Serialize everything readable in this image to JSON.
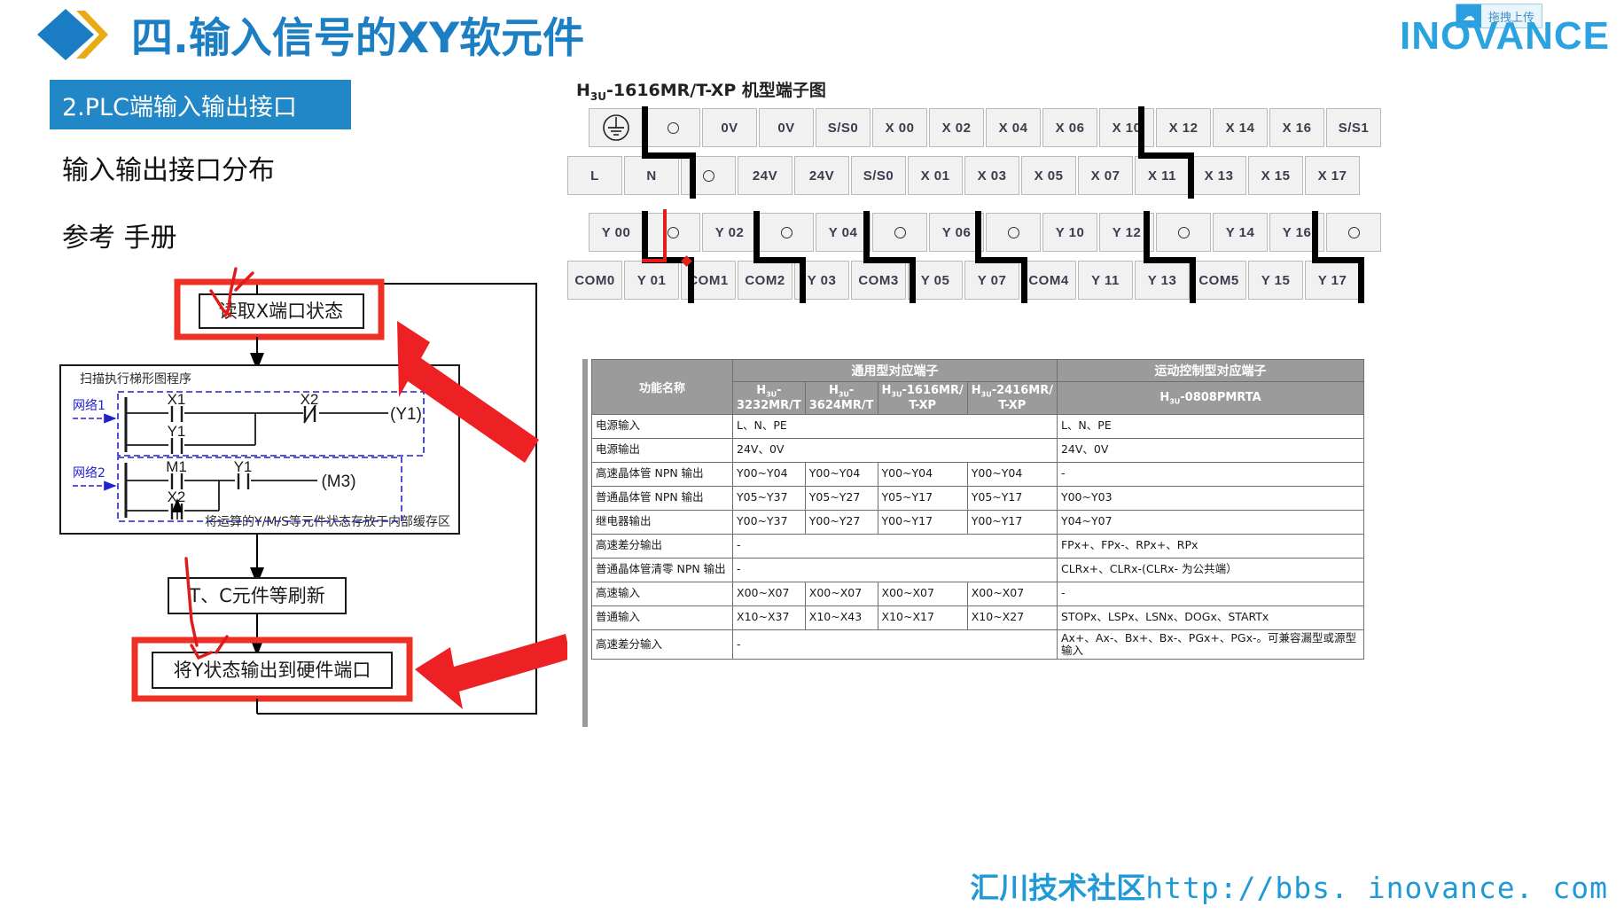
{
  "header": {
    "title": "四.输入信号的XY软元件",
    "brand": "INOVANCE",
    "upload_badge": {
      "icon": "cloud-upload-icon",
      "label": "拖拽上传"
    },
    "accent_color": "#1d7fc3",
    "brand_color": "#2aa3e0"
  },
  "left": {
    "section_chip": "2.PLC端输入输出接口",
    "chip_color": "#2287c6",
    "heading_1": "输入输出接口分布",
    "heading_2": "参考 手册",
    "flow": {
      "step_read_x": "读取X端口状态",
      "scan_box_title": "扫描执行梯形图程序",
      "scan_box_note": "将运算的Y/M/S等元件状态存放于内部缓存区",
      "step_refresh": "T、C元件等刷新",
      "step_write_y": "将Y状态输出到硬件端口",
      "network1_label": "网络1",
      "network2_label": "网络2",
      "ladder": {
        "net1": {
          "contacts": [
            "X1",
            "Y1",
            "X2"
          ],
          "coil": "(Y1)"
        },
        "net2": {
          "contacts": [
            "M1",
            "Y1",
            "X2"
          ],
          "coil": "(M3)"
        }
      },
      "highlight_color": "#ee3124"
    }
  },
  "terminal": {
    "title": "H3U-1616MR/T-XP 机型端子图",
    "title_prefix": "H",
    "title_sub": "3U",
    "title_rest": "-1616MR/T-XP 机型端子图",
    "row1": [
      "ground-icon",
      "circle",
      "0V",
      "0V",
      "S/S0",
      "X 00",
      "X 02",
      "X 04",
      "X 06",
      "X 10",
      "X 12",
      "X 14",
      "X 16",
      "S/S1"
    ],
    "row2": [
      "L",
      "N",
      "circle",
      "24V",
      "24V",
      "S/S0",
      "X 01",
      "X 03",
      "X 05",
      "X 07",
      "X 11",
      "X 13",
      "X 15",
      "X 17"
    ],
    "row3": [
      "Y 00",
      "circle",
      "Y 02",
      "circle",
      "Y 04",
      "circle",
      "Y 06",
      "circle",
      "Y 10",
      "Y 12",
      "circle",
      "Y 14",
      "Y 16",
      "circle"
    ],
    "row4": [
      "COM0",
      "Y 01",
      "COM1",
      "COM2",
      "Y 03",
      "COM3",
      "Y 05",
      "Y 07",
      "COM4",
      "Y 11",
      "Y 13",
      "COM5",
      "Y 15",
      "Y 17"
    ]
  },
  "spec_table": {
    "group_general": "通用型对应端子",
    "group_motion": "运动控制型对应端子",
    "col_function": "功能名称",
    "columns": [
      {
        "line1": "H3U-",
        "line2": "3232MR/T"
      },
      {
        "line1": "H3U-",
        "line2": "3624MR/T"
      },
      {
        "line1": "H3U-1616MR/",
        "line2": "T-XP"
      },
      {
        "line1": "H3U-2416MR/",
        "line2": "T-XP"
      }
    ],
    "col_motion": "H3U-0808PMRTA",
    "rows": [
      {
        "fn": "电源输入",
        "merged": "L、N、PE",
        "motion": "L、N、PE"
      },
      {
        "fn": "电源输出",
        "merged": "24V、0V",
        "motion": "24V、0V"
      },
      {
        "fn": "高速晶体管 NPN 输出",
        "cells": [
          "Y00~Y04",
          "Y00~Y04",
          "Y00~Y04",
          "Y00~Y04"
        ],
        "motion": "-"
      },
      {
        "fn": "普通晶体管 NPN 输出",
        "cells": [
          "Y05~Y37",
          "Y05~Y27",
          "Y05~Y17",
          "Y05~Y17"
        ],
        "motion": "Y00~Y03"
      },
      {
        "fn": "继电器输出",
        "cells": [
          "Y00~Y37",
          "Y00~Y27",
          "Y00~Y17",
          "Y00~Y17"
        ],
        "motion": "Y04~Y07"
      },
      {
        "fn": "高速差分输出",
        "merged": "-",
        "motion": "FPx+、FPx-、RPx+、RPx"
      },
      {
        "fn": "普通晶体管清零 NPN 输出",
        "merged": "-",
        "motion": "CLRx+、CLRx-(CLRx- 为公共端）"
      },
      {
        "fn": "高速输入",
        "cells": [
          "X00~X07",
          "X00~X07",
          "X00~X07",
          "X00~X07"
        ],
        "motion": "-"
      },
      {
        "fn": "普通输入",
        "cells": [
          "X10~X37",
          "X10~X43",
          "X10~X17",
          "X10~X27"
        ],
        "motion": "STOPx、LSPx、LSNx、DOGx、STARTx"
      },
      {
        "fn": "高速差分输入",
        "merged": "-",
        "motion": "Ax+、Ax-、Bx+、Bx-、PGx+、PGx-。可兼容漏型或源型输入"
      }
    ]
  },
  "footer": {
    "text_cn": "汇川技术社区",
    "url": "http://bbs. inovance. com",
    "color": "#1f9ad6"
  }
}
